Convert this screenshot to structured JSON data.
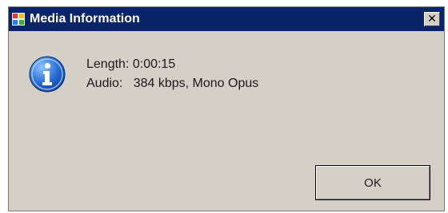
{
  "window": {
    "title": "Media Information",
    "close_glyph": "✕",
    "icons": {
      "app": "media-app-icon",
      "close": "close-icon"
    }
  },
  "info": {
    "icon": "info-icon",
    "length_label": "Length:",
    "length_value": "0:00:15",
    "audio_label": "Audio:",
    "audio_value": "384 kbps, Mono Opus"
  },
  "buttons": {
    "ok_label": "OK"
  },
  "colors": {
    "titlebar": "#0a246a",
    "dialog_face": "#d4d0c8",
    "info_icon": "#2a6fd6"
  }
}
